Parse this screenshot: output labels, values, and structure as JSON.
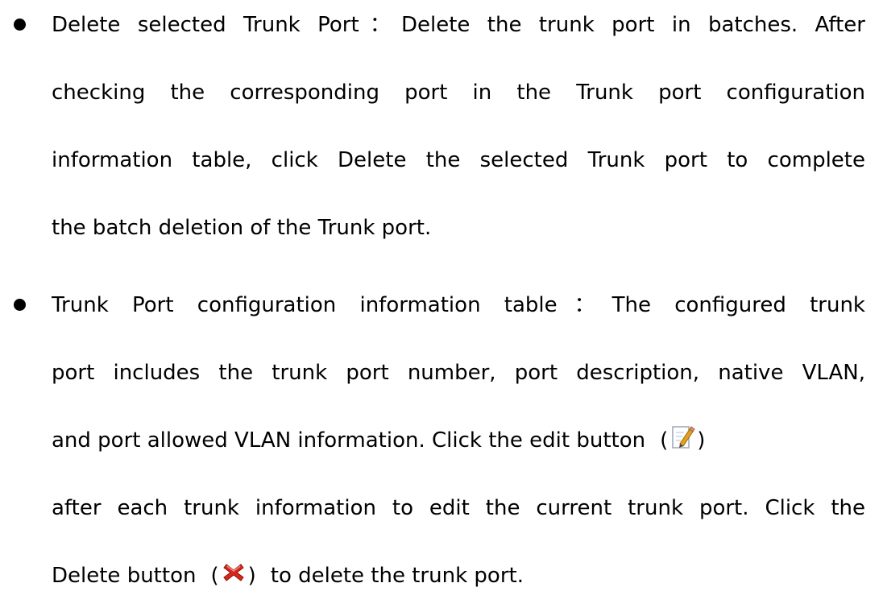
{
  "items": [
    {
      "heading": "Delete selected Trunk Port",
      "separator": "：",
      "lines": [
        "Delete the trunk port in batches. After",
        "checking the corresponding port in the Trunk port configuration",
        "information table, click Delete the selected Trunk port to complete",
        "the batch deletion of the Trunk port."
      ]
    },
    {
      "heading": "Trunk Port configuration information table",
      "separator": "：",
      "line1_rest": "The configured trunk",
      "line2": "port includes the trunk port number, port description, native VLAN,",
      "line3_before": "and port allowed VLAN information. Click the edit button",
      "line4": "after each trunk information to edit the current trunk port. Click the",
      "line5_before": "Delete button",
      "line5_after": "to delete the trunk port.",
      "paren_open": "(",
      "paren_close": ")",
      "edit_icon": "edit-pencil-icon",
      "delete_icon": "red-x-delete-icon"
    }
  ],
  "colors": {
    "text": "#000000",
    "delete_icon": "#d9261c",
    "edit_icon_pencil": "#e0a020"
  }
}
